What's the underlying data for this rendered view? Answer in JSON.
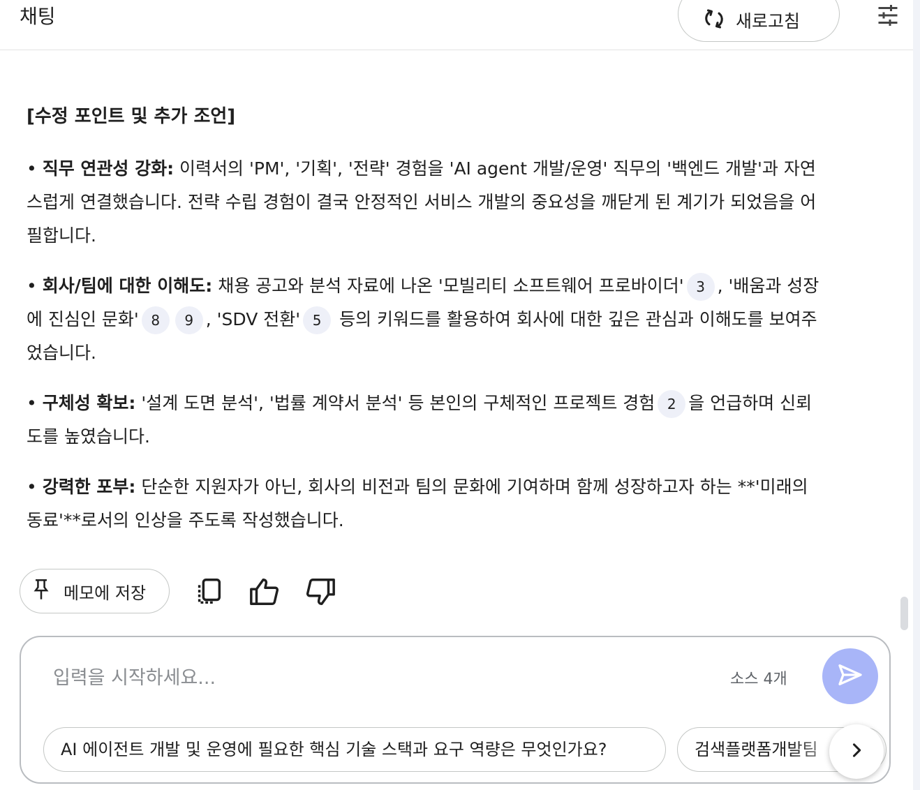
{
  "header": {
    "title": "채팅",
    "refresh_label": "새로고침"
  },
  "answer": {
    "heading": "[수정 포인트 및 추가 조언]",
    "points": [
      {
        "bullet": "•",
        "title": "직무 연관성 강화:",
        "text": " 이력서의 'PM', '기획', '전략' 경험을 'AI agent 개발/운영' 직무의 '백엔드 개발'과 자연스럽게 연결했습니다. 전략 수립 경험이 결국 안정적인 서비스 개발의 중요성을 깨닫게 된 계기가 되었음을 어필합니다."
      },
      {
        "bullet": "•",
        "title": "회사/팀에 대한 이해도:",
        "text_a": " 채용 공고와 분석 자료에 나온 '모빌리티 소프트웨어 프로바이더'",
        "cite_a": "3",
        "text_b": ", '배움과 성장에 진심인 문화'",
        "cite_b1": "8",
        "cite_b2": "9",
        "text_c": ", 'SDV 전환'",
        "cite_c": "5",
        "text_d": " 등의 키워드를 활용하여 회사에 대한 깊은 관심과 이해도를 보여주었습니다."
      },
      {
        "bullet": "•",
        "title": "구체성 확보:",
        "text_a": " '설계 도면 분석', '법률 계약서 분석' 등 본인의 구체적인 프로젝트 경험",
        "cite_a": "2",
        "text_b": "을 언급하며 신뢰도를 높였습니다."
      },
      {
        "bullet": "•",
        "title": "강력한 포부:",
        "text": " 단순한 지원자가 아닌, 회사의 비전과 팀의 문화에 기여하며 함께 성장하고자 하는 **'미래의 동료'**로서의 인상을 주도록 작성했습니다."
      }
    ]
  },
  "actions": {
    "save_memo_label": "메모에 저장"
  },
  "composer": {
    "placeholder": "입력을 시작하세요...",
    "source_count": "소스 4개",
    "suggestions": [
      "AI 에이전트 개발 및 운영에 필요한 핵심 기술 스택과 요구 역량은 무엇인가요?",
      "검색플랫폼개발팀"
    ]
  },
  "colors": {
    "send_button": "#a8b5f8",
    "citation_bg": "#eef0f8",
    "border": "#c4c7c5"
  }
}
